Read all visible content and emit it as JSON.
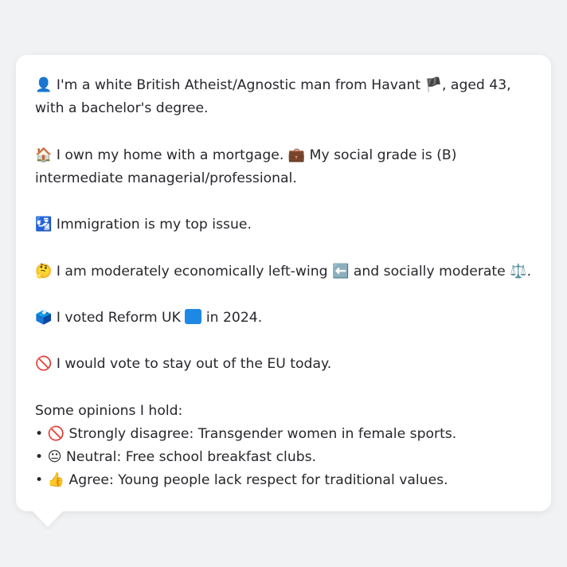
{
  "bio": {
    "identity": {
      "icon": "👤",
      "text_before_flag": "I'm a white British Atheist/Agnostic man from Havant",
      "flag": "🏴",
      "text_after_flag": ", aged 43, with a bachelor's degree."
    },
    "home": {
      "icon": "🏠",
      "text": "I own my home with a mortgage.",
      "grade_icon": "💼",
      "grade_text": "My social grade is (B) intermediate managerial/professional."
    },
    "issue": {
      "icon": "🛂",
      "text": "Immigration is my top issue."
    },
    "ideology": {
      "icon": "🤔",
      "text_before": "I am moderately economically left-wing",
      "left_icon": "⬅️",
      "text_middle": "and socially moderate",
      "scale_icon": "⚖️",
      "text_end": "."
    },
    "vote": {
      "icon": "🗳️",
      "text_before": "I voted Reform UK",
      "party_color": "#1e88e5",
      "text_after": "in 2024."
    },
    "eu": {
      "icon": "🚫",
      "text": "I would vote to stay out of the EU today."
    }
  },
  "opinions": {
    "heading": "Some opinions I hold:",
    "bullet": "•",
    "items": [
      {
        "icon": "🚫",
        "text": "Strongly disagree: Transgender women in female sports."
      },
      {
        "icon": "😐",
        "text": "Neutral: Free school breakfast clubs."
      },
      {
        "icon": "👍",
        "text": "Agree: Young people lack respect for traditional values."
      }
    ]
  }
}
